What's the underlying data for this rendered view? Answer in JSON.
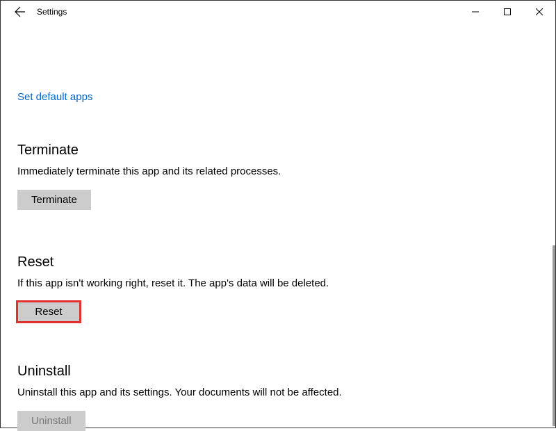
{
  "window": {
    "title": "Settings"
  },
  "link": {
    "set_default_apps": "Set default apps"
  },
  "sections": {
    "terminate": {
      "heading": "Terminate",
      "description": "Immediately terminate this app and its related processes.",
      "button_label": "Terminate"
    },
    "reset": {
      "heading": "Reset",
      "description": "If this app isn't working right, reset it. The app's data will be deleted.",
      "button_label": "Reset"
    },
    "uninstall": {
      "heading": "Uninstall",
      "description": "Uninstall this app and its settings. Your documents will not be affected.",
      "button_label": "Uninstall"
    }
  }
}
